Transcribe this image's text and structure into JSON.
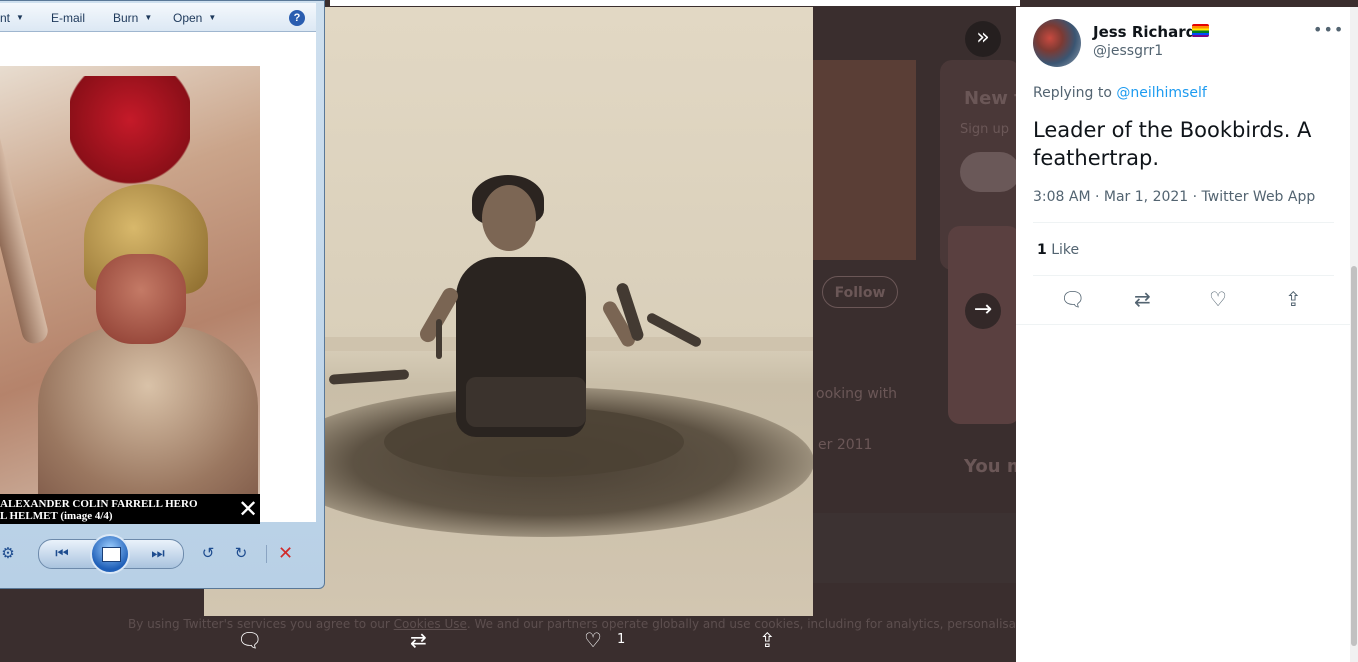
{
  "background": {
    "heading_new": "New t",
    "heading_you": "You m",
    "signup_hint": "Sign up",
    "follow_label": "Follow",
    "looking_text": "ooking with",
    "date_text": "er 2011",
    "cookie_prefix": "By using Twitter's services you agree to our ",
    "cookie_link": "Cookies Use",
    "cookie_suffix": ". We and our partners operate globally and use cookies, including for analytics, personalisation, and"
  },
  "media_actions": {
    "like_count": "1"
  },
  "photo_viewer": {
    "menu": [
      {
        "label": "nt",
        "has_caret": true
      },
      {
        "label": "E-mail",
        "has_caret": false
      },
      {
        "label": "Burn",
        "has_caret": true
      },
      {
        "label": "Open",
        "has_caret": true
      }
    ],
    "help_label": "?",
    "caption_line1": "ALEXANDER COLIN FARRELL HERO",
    "caption_line2": "L HELMET (image 4/4)",
    "close_glyph": "✕"
  },
  "tweet": {
    "display_name": "Jess Richards",
    "handle": "@jessgrr1",
    "replying_prefix": "Replying to ",
    "replying_to": "@neilhimself",
    "text": "Leader of the Bookbirds. A feathertrap.",
    "time": "3:08 AM · Mar 1, 2021 · Twitter Web App",
    "like_count": "1",
    "like_label": "Like"
  },
  "icons": {
    "collapse": "chevrons-right-icon",
    "next": "arrow-right-icon",
    "reply": "reply-icon",
    "retweet": "retweet-icon",
    "like": "heart-icon",
    "share": "share-icon",
    "more": "more-icon"
  },
  "colors": {
    "link": "#1d9bf0",
    "text_primary": "#0f1419",
    "text_secondary": "#536471",
    "overlay": "#3a2e2e"
  }
}
